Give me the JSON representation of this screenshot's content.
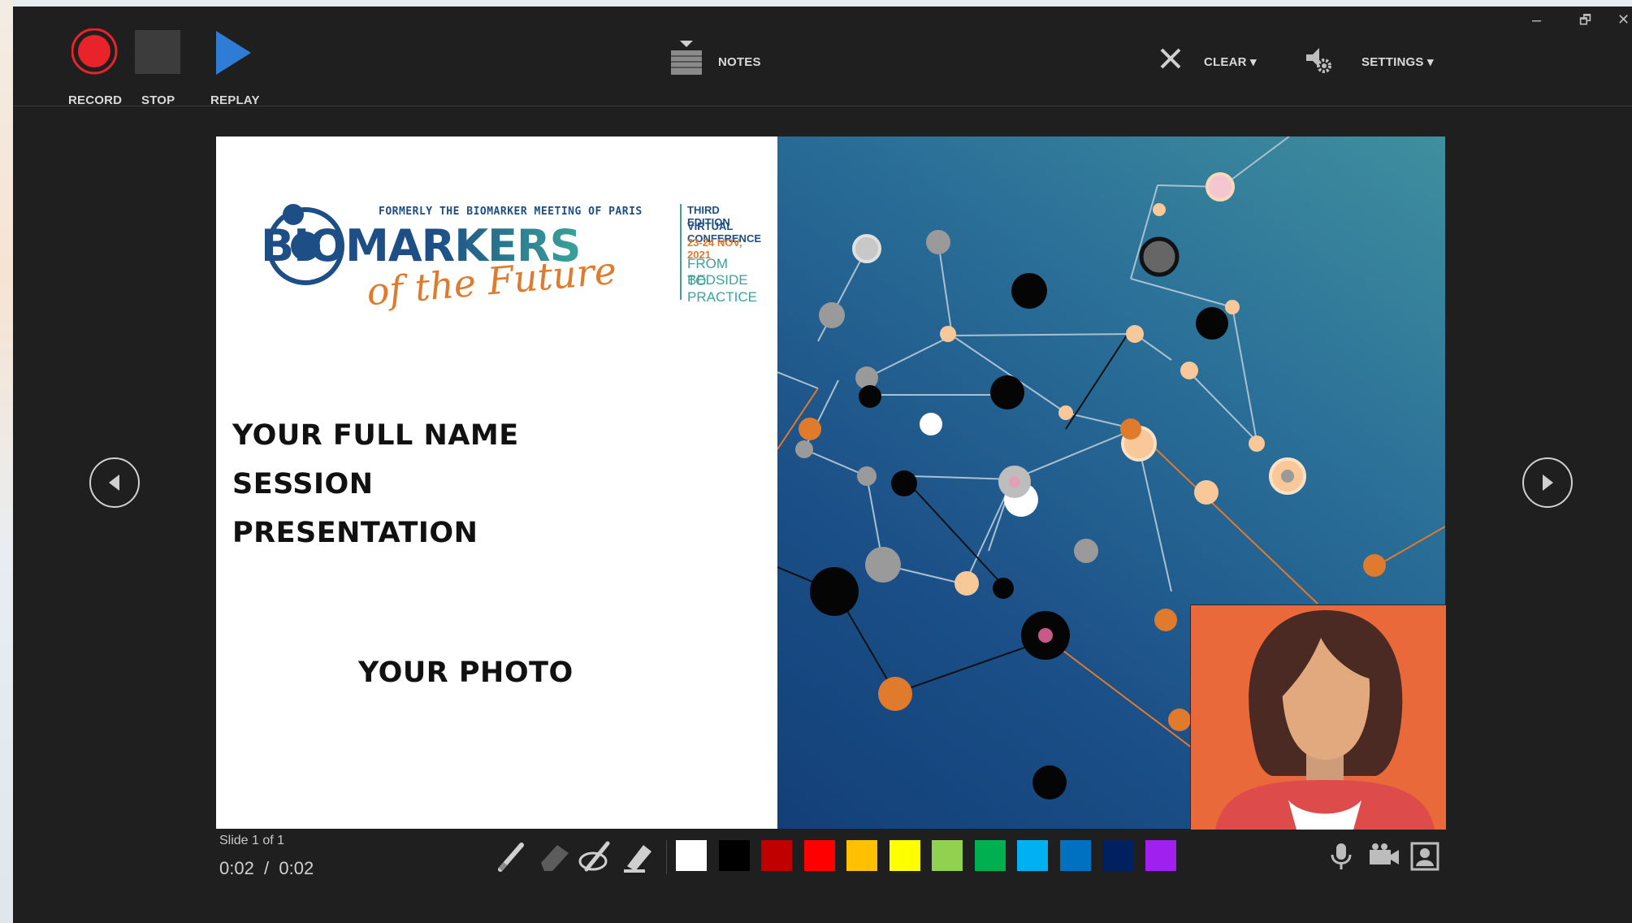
{
  "toolbar": {
    "record_label": "RECORD",
    "stop_label": "STOP",
    "replay_label": "REPLAY",
    "notes_label": "NOTES",
    "clear_label": "CLEAR ▾",
    "settings_label": "SETTINGS ▾"
  },
  "window": {
    "minimize": "–",
    "restore": "🗗",
    "close": "✕"
  },
  "slide": {
    "logo": {
      "formerly": "FORMERLY THE BIOMARKER MEETING OF PARIS",
      "brand": "BIOMARKERS",
      "script": "of the Future",
      "edition": "THIRD EDITION",
      "conference": "VIRTUAL CONFERENCE",
      "dates": "23-24 NOV, 2021",
      "tagline1": "FROM BEDSIDE",
      "tagline2": "TO PRACTICE"
    },
    "name": "YOUR FULL NAME",
    "session": "SESSION",
    "presentation": "PRESENTATION",
    "photo": "YOUR PHOTO"
  },
  "status": {
    "slide_counter": "Slide 1 of 1",
    "time": "0:02  /  0:02"
  },
  "palette": {
    "colors": [
      "#ffffff",
      "#000000",
      "#c00000",
      "#ff0000",
      "#ffc000",
      "#ffff00",
      "#92d050",
      "#00b050",
      "#00b0f0",
      "#0070c0",
      "#002060",
      "#a020f0"
    ]
  },
  "tools": [
    "pen-icon",
    "eraser-icon",
    "laser-pen-icon",
    "highlighter-icon"
  ],
  "media_icons": [
    "microphone-icon",
    "camera-icon",
    "camera-preview-icon"
  ],
  "accent": {
    "record": "#e8232a",
    "replay": "#2e7cd6",
    "cam_bg": "#e9693a"
  }
}
